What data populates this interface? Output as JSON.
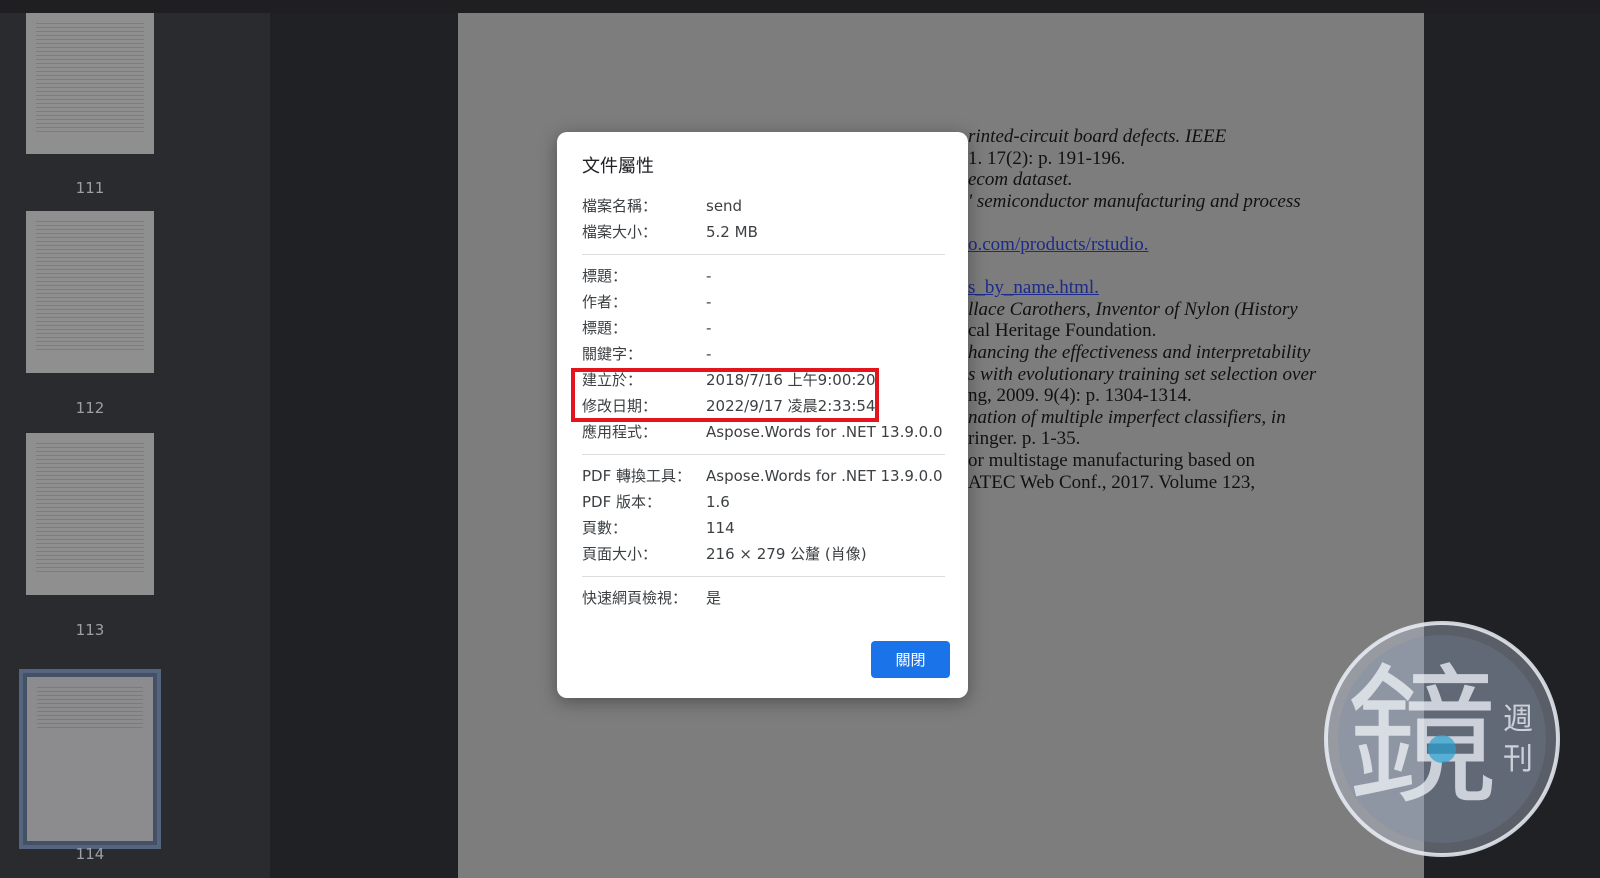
{
  "sidebar": {
    "thumbnails": [
      {
        "number": "111"
      },
      {
        "number": "112"
      },
      {
        "number": "113"
      },
      {
        "number": "114",
        "selected": true
      }
    ]
  },
  "page_text": {
    "lines": [
      {
        "text": "rinted-circuit board defects. IEEE",
        "style": "it-part"
      },
      {
        "text": "1. 17(2): p. 191-196."
      },
      {
        "text": "ecom dataset."
      },
      {
        "text": "' semiconductor manufacturing and process"
      },
      {
        "text": ""
      },
      {
        "text": "o.com/products/rstudio."
      },
      {
        "text": ""
      },
      {
        "text": "s_by_name.html."
      },
      {
        "text": "llace Carothers, Inventor of Nylon (History"
      },
      {
        "text": "cal Heritage Foundation."
      },
      {
        "text": "hancing the effectiveness and interpretability"
      },
      {
        "text": "s with evolutionary training set selection over"
      },
      {
        "text": "ng, 2009. 9(4): p. 1304-1314."
      },
      {
        "text": "nation of multiple imperfect classifiers, in"
      },
      {
        "text": "ringer. p. 1-35."
      },
      {
        "text": "or multistage manufacturing based on"
      },
      {
        "text": "ATEC Web Conf., 2017. Volume 123,"
      }
    ]
  },
  "dialog": {
    "title": "文件屬性",
    "groups": [
      [
        {
          "key": "檔案名稱：",
          "value": "send"
        },
        {
          "key": "檔案大小：",
          "value": "5.2 MB"
        }
      ],
      [
        {
          "key": "標題：",
          "value": "-"
        },
        {
          "key": "作者：",
          "value": "-"
        },
        {
          "key": "標題：",
          "value": "-"
        },
        {
          "key": "關鍵字：",
          "value": "-"
        },
        {
          "key": "建立於：",
          "value": "2018/7/16 上午9:00:20"
        },
        {
          "key": "修改日期：",
          "value": "2022/9/17 凌晨2:33:54"
        },
        {
          "key": "應用程式：",
          "value": "Aspose.Words for .NET 13.9.0.0"
        }
      ],
      [
        {
          "key": "PDF 轉換工具：",
          "value": "Aspose.Words for .NET 13.9.0.0"
        },
        {
          "key": "PDF 版本：",
          "value": "1.6"
        },
        {
          "key": "頁數：",
          "value": "114"
        },
        {
          "key": "頁面大小：",
          "value": "216 × 279 公釐 (肖像)"
        }
      ],
      [
        {
          "key": "快速網頁檢視：",
          "value": "是"
        }
      ]
    ],
    "close_label": "關閉",
    "accent_color": "#1a73e8",
    "highlight_color": "#e5131b"
  },
  "watermark": {
    "main_char": "鏡",
    "sub_chars": "週刊"
  }
}
